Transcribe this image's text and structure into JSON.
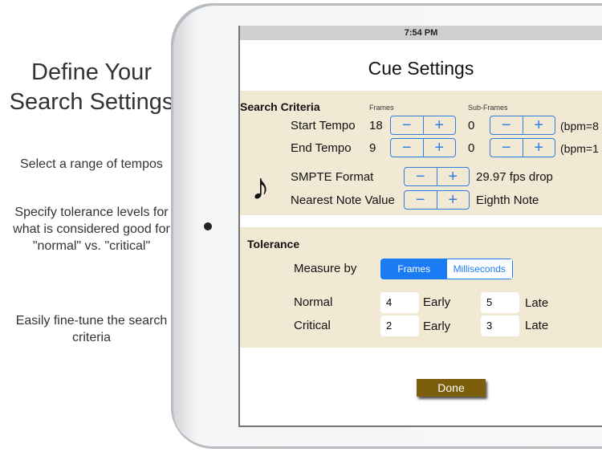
{
  "promo": {
    "title": "Define Your Search Settings",
    "bullets": [
      "Select a range of tempos",
      "Specify tolerance levels for what is considered good for \"normal\" vs. \"critical\"",
      "Easily fine-tune the search criteria"
    ]
  },
  "status_time": "7:54 PM",
  "title": "Cue Settings",
  "search": {
    "heading": "Search Criteria",
    "frames_label": "Frames",
    "subframes_label": "Sub-Frames",
    "rows": [
      {
        "label": "Start Tempo",
        "frames": "18",
        "subframes": "0",
        "bpm": "(bpm=8"
      },
      {
        "label": "End Tempo",
        "frames": "9",
        "subframes": "0",
        "bpm": "(bpm=1"
      }
    ],
    "smpte_label": "SMPTE Format",
    "smpte_value": "29.97 fps drop",
    "note_label": "Nearest Note Value",
    "note_value": "Eighth Note",
    "note_icon": "♪",
    "minus": "−",
    "plus": "+"
  },
  "tolerance": {
    "heading": "Tolerance",
    "measure_label": "Measure by",
    "options": [
      "Frames",
      "Milliseconds"
    ],
    "selected": "Frames",
    "rows": [
      {
        "label": "Normal",
        "early": "4",
        "early_label": "Early",
        "late": "5",
        "late_label": "Late"
      },
      {
        "label": "Critical",
        "early": "2",
        "early_label": "Early",
        "late": "3",
        "late_label": "Late"
      }
    ]
  },
  "done_label": "Done",
  "colors": {
    "accent": "#1a7cf5",
    "beige": "#f2e9d5",
    "done": "#7c5e0c"
  }
}
